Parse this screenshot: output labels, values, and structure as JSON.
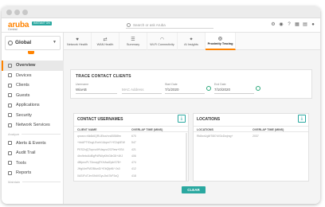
{
  "brand": {
    "name": "aruba",
    "subtitle": "Central",
    "badge": "INSTANT ON"
  },
  "search": {
    "placeholder": "Search or ask Aruba"
  },
  "context": {
    "label": "Global"
  },
  "sidebar": {
    "items": [
      {
        "label": "Overview",
        "active": true
      },
      {
        "label": "Devices"
      },
      {
        "label": "Clients"
      },
      {
        "label": "Guests"
      },
      {
        "label": "Applications"
      },
      {
        "label": "Security"
      },
      {
        "label": "Network Services"
      }
    ],
    "section_analyze": "Analyze",
    "analyze_items": [
      {
        "label": "Alerts & Events"
      },
      {
        "label": "Audit Trail"
      },
      {
        "label": "Tools"
      },
      {
        "label": "Reports"
      }
    ],
    "section_maintain": "Maintain"
  },
  "tabs": [
    {
      "label": "Network Health",
      "icon": "heart-icon"
    },
    {
      "label": "WAN Health",
      "icon": "wan-icon"
    },
    {
      "label": "Summary",
      "icon": "summary-icon"
    },
    {
      "label": "Wi-Fi Connectivity",
      "icon": "wifi-icon"
    },
    {
      "label": "AI Insights",
      "icon": "bulb-icon"
    },
    {
      "label": "Proximity Tracing",
      "icon": "tracing-icon",
      "active": true
    }
  ],
  "trace": {
    "title": "TRACE CONTACT CLIENTS",
    "username": {
      "label": "Username",
      "value": "WiaAB"
    },
    "mac": {
      "placeholder": "MAC Address"
    },
    "start": {
      "label": "Start Date",
      "value": "7/1/2020"
    },
    "end": {
      "label": "End Date",
      "value": "7/10/2020"
    }
  },
  "users_table": {
    "title": "CONTACT USERNAMES",
    "headers": [
      "CLIENT NAME",
      "OVERLAP TIME (MINS)"
    ],
    "rows": [
      [
        "qrwan=r6k6k6QRUEbw/nn4BSt8fm",
        "670"
      ],
      [
        "+hbAPTfOcgLEveh1iAqm/Y+E2ql4EW",
        "547"
      ],
      [
        "PESZxjQTopvu4HVaqzu/2CRew+0S4",
        "421"
      ],
      [
        "4bn9ebd4dBgPdRWpKfhGlbG8+4KJ",
        "406"
      ],
      [
        "4BfpeoPLT3mwpjFKHAwlDpbS7B+",
        "474"
      ],
      [
        "JHgl4mFMOBkvd2/+EbQfpf6/+Js0",
        "412"
      ],
      [
        "0ASIFuTJmS9dVGycJlx47kP3xQ",
        "418"
      ]
    ]
  },
  "locations_table": {
    "title": "LOCATIONS",
    "headers": [
      "LOCATIONS",
      "OVERLAP TIME (MINS)"
    ],
    "rows": [
      [
        "Rk8wrUgMTi8l7dV3cDwjmg+",
        "2037"
      ]
    ]
  },
  "actions": {
    "clear": "CLEAR"
  },
  "colors": {
    "accent": "#ff8300",
    "teal": "#2aa8a0"
  }
}
